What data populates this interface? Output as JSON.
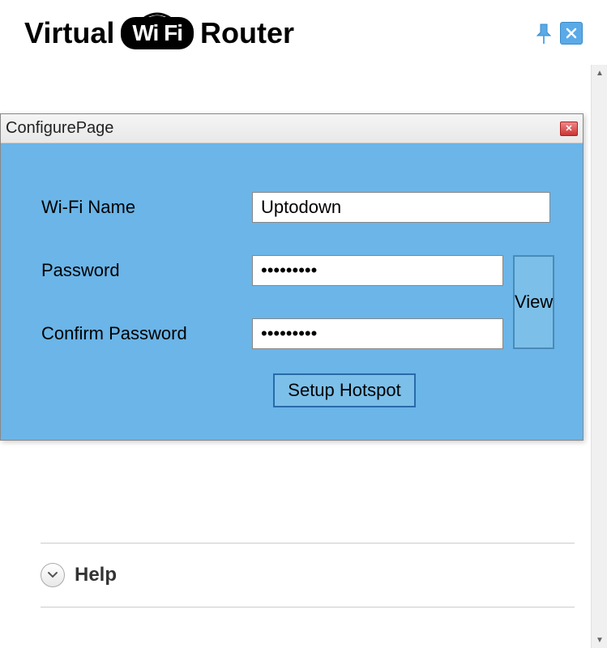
{
  "header": {
    "title_part1": "Virtual",
    "title_badge": "Wi Fi",
    "title_part2": "Router"
  },
  "dialog": {
    "title": "ConfigurePage",
    "fields": {
      "wifi_name_label": "Wi-Fi Name",
      "wifi_name_value": "Uptodown",
      "password_label": "Password",
      "password_value": "•••••••••",
      "confirm_label": "Confirm Password",
      "confirm_value": "•••••••••"
    },
    "view_button": "View",
    "setup_button": "Setup Hotspot"
  },
  "help": {
    "label": "Help"
  }
}
